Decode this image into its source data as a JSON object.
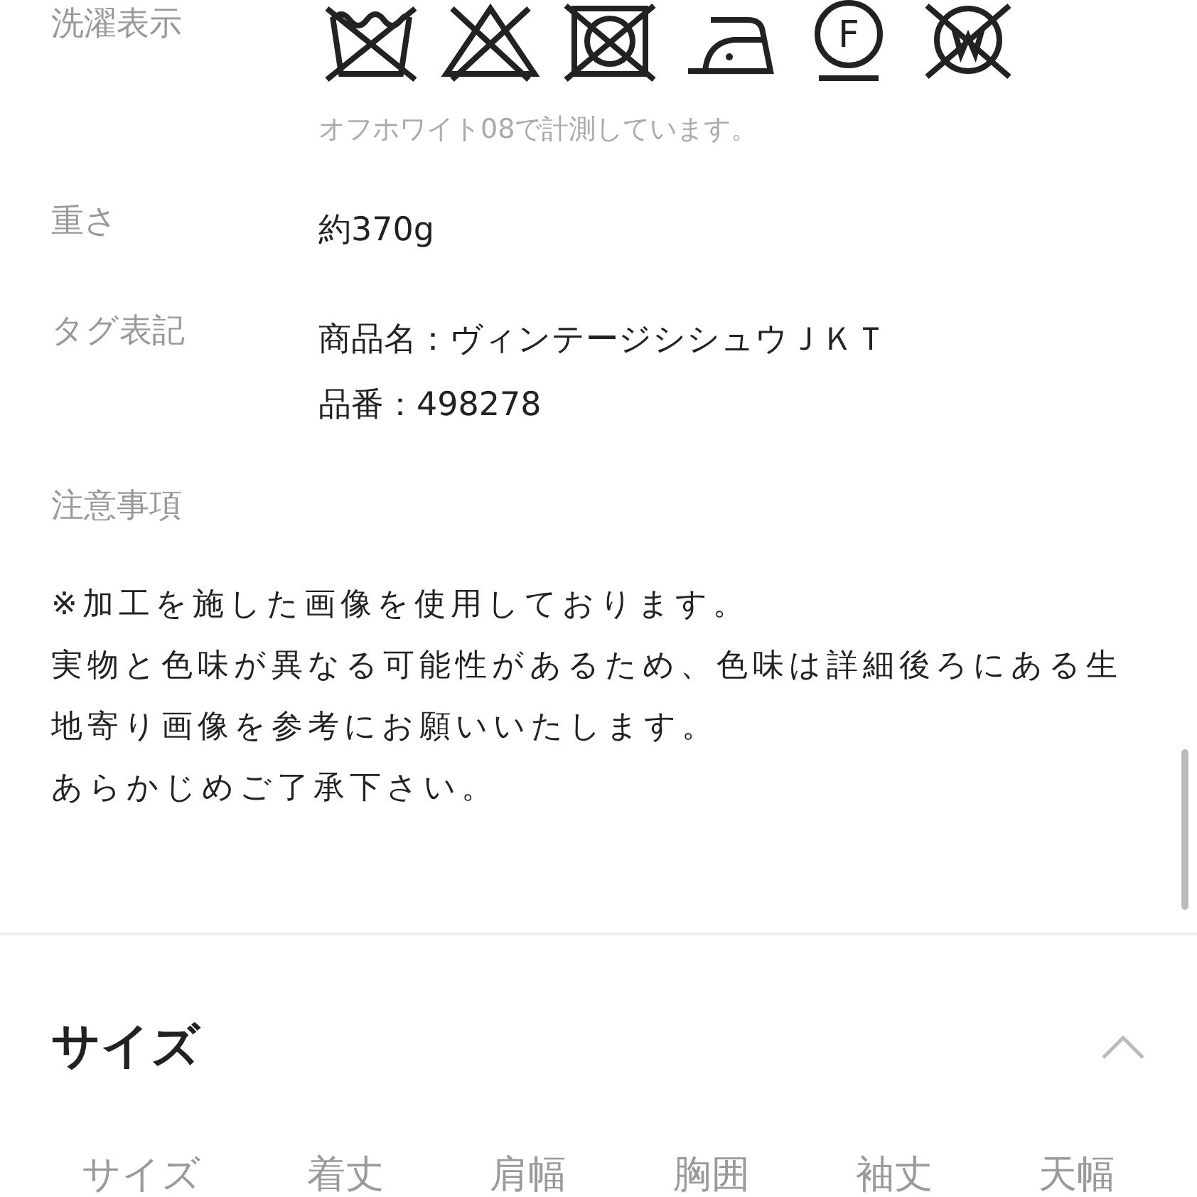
{
  "details": [
    {
      "label": "洗濯表示",
      "symbols": [
        {
          "kind": "wash"
        },
        {
          "kind": "bleach"
        },
        {
          "kind": "dryer"
        },
        {
          "kind": "iron"
        },
        {
          "kind": "dryclean",
          "letter": "F"
        },
        {
          "kind": "wetclean"
        }
      ],
      "note": "オフホワイト08で計測しています。"
    },
    {
      "label": "重さ",
      "lines": [
        "約370g"
      ]
    },
    {
      "label": "タグ表記",
      "lines": [
        "商品名：ヴィンテージシシュウＪＫＴ",
        "品番：498278"
      ]
    },
    {
      "label": "注意事項"
    }
  ],
  "notice": [
    "※加工を施した画像を使用しております。",
    "実物と色味が異なる可能性があるため、色味は詳細後ろにある生地寄り画像を参考にお願いいたします。",
    "あらかじめご了承下さい。"
  ],
  "size_section": {
    "title": "サイズ",
    "expanded": true,
    "columns": [
      "サイズ",
      "着丈",
      "肩幅",
      "胸囲",
      "袖丈",
      "天幅"
    ]
  }
}
